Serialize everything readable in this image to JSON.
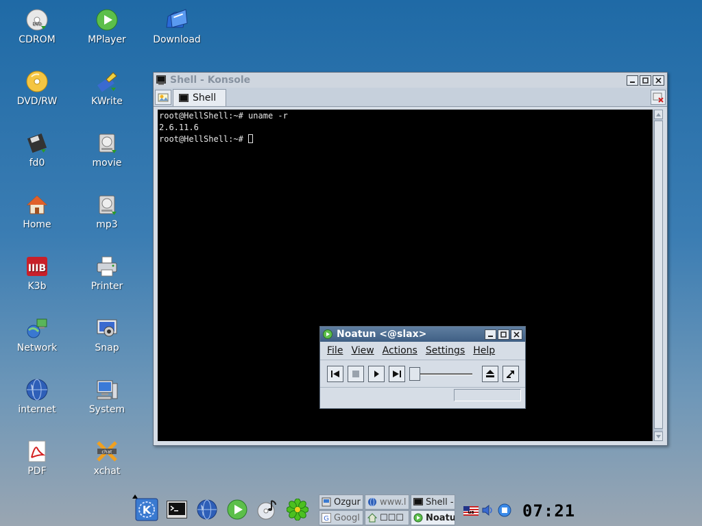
{
  "desktop": {
    "icons": [
      {
        "label": "CDROM",
        "icon": "cdrom-icon"
      },
      {
        "label": "MPlayer",
        "icon": "mplayer-icon"
      },
      {
        "label": "Download",
        "icon": "folder-icon"
      },
      {
        "label": "DVD/RW",
        "icon": "dvd-icon"
      },
      {
        "label": "KWrite",
        "icon": "kwrite-icon"
      },
      {
        "label": "fd0",
        "icon": "floppy-icon"
      },
      {
        "label": "movie",
        "icon": "harddisk-icon"
      },
      {
        "label": "Home",
        "icon": "home-icon"
      },
      {
        "label": "mp3",
        "icon": "harddisk-icon"
      },
      {
        "label": "K3b",
        "icon": "k3b-icon"
      },
      {
        "label": "Printer",
        "icon": "printer-icon"
      },
      {
        "label": "Network",
        "icon": "network-icon"
      },
      {
        "label": "Snap",
        "icon": "camera-icon"
      },
      {
        "label": "internet",
        "icon": "globe-icon"
      },
      {
        "label": "System",
        "icon": "computer-icon"
      },
      {
        "label": "PDF",
        "icon": "pdf-icon"
      },
      {
        "label": "xchat",
        "icon": "xchat-icon"
      }
    ]
  },
  "konsole": {
    "title": "Shell - Konsole",
    "tab_label": "Shell",
    "lines": [
      "root@HellShell:~# uname -r",
      "2.6.11.6",
      "root@HellShell:~# "
    ]
  },
  "noatun": {
    "title": "Noatun <@slax>",
    "menu": [
      "File",
      "View",
      "Actions",
      "Settings",
      "Help"
    ]
  },
  "taskbar": {
    "launchers": [
      "kde-menu-icon",
      "terminal-icon",
      "browser-icon",
      "media-player-icon",
      "music-disc-icon",
      "icq-flower-icon"
    ],
    "tasks": [
      {
        "label": "Ozgur",
        "icon": "file-manager-icon",
        "active": false
      },
      {
        "label": "www.l",
        "icon": "browser-icon",
        "active": false
      },
      {
        "label": "Shell -",
        "icon": "terminal-icon",
        "active": false
      },
      {
        "label": "Googl",
        "icon": "google-icon",
        "active": false
      },
      {
        "label": "☐☐☐",
        "icon": "home-icon",
        "active": false
      },
      {
        "label": "Noatu",
        "icon": "noatun-icon",
        "active": true
      }
    ],
    "tray": {
      "keyboard_layout": "us"
    },
    "clock": "07:21"
  },
  "colors": {
    "desktop_top": "#1f6aa6",
    "desktop_bottom": "#9aa6b2",
    "active_title": "#3f5f84",
    "terminal_bg": "#000000"
  }
}
